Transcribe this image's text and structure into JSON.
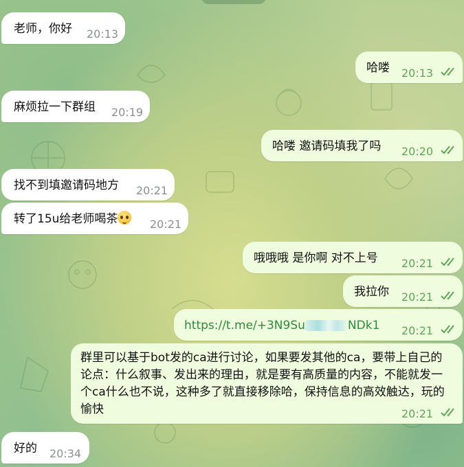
{
  "messages": [
    {
      "text": "老师，你好",
      "time": "20:13"
    },
    {
      "text": "哈喽",
      "time": "20:13"
    },
    {
      "text": "麻烦拉一下群组",
      "time": "20:19"
    },
    {
      "text": "哈喽  邀请码填我了吗",
      "time": "20:20"
    },
    {
      "text": "找不到填邀请码地方",
      "time": "20:21"
    },
    {
      "text": "转了15u给老师喝茶",
      "time": "20:21"
    },
    {
      "text": "哦哦哦  是你啊  对不上号",
      "time": "20:21"
    },
    {
      "text": "我拉你",
      "time": "20:21"
    },
    {
      "link_start": "https://t.me/+3N9Su",
      "link_end": "NDk1",
      "time": "20:21"
    },
    {
      "text": "群里可以基于bot发的ca进行讨论，如果要发其他的ca，要带上自己的论点：什么叙事、发出来的理由，就是要有高质量的内容，不能就发一个ca什么也不说，这种多了就直接移除哈，保持信息的高效触达，玩的愉快",
      "time": "20:21"
    },
    {
      "text": "好的",
      "time": "20:34"
    }
  ],
  "colors": {
    "incoming": "#ffffff",
    "outgoing": "#effdde",
    "read_check": "#5fa557"
  },
  "icons": {
    "read_receipt": "double-check-icon",
    "emoji": "pleading-face-emoji"
  }
}
